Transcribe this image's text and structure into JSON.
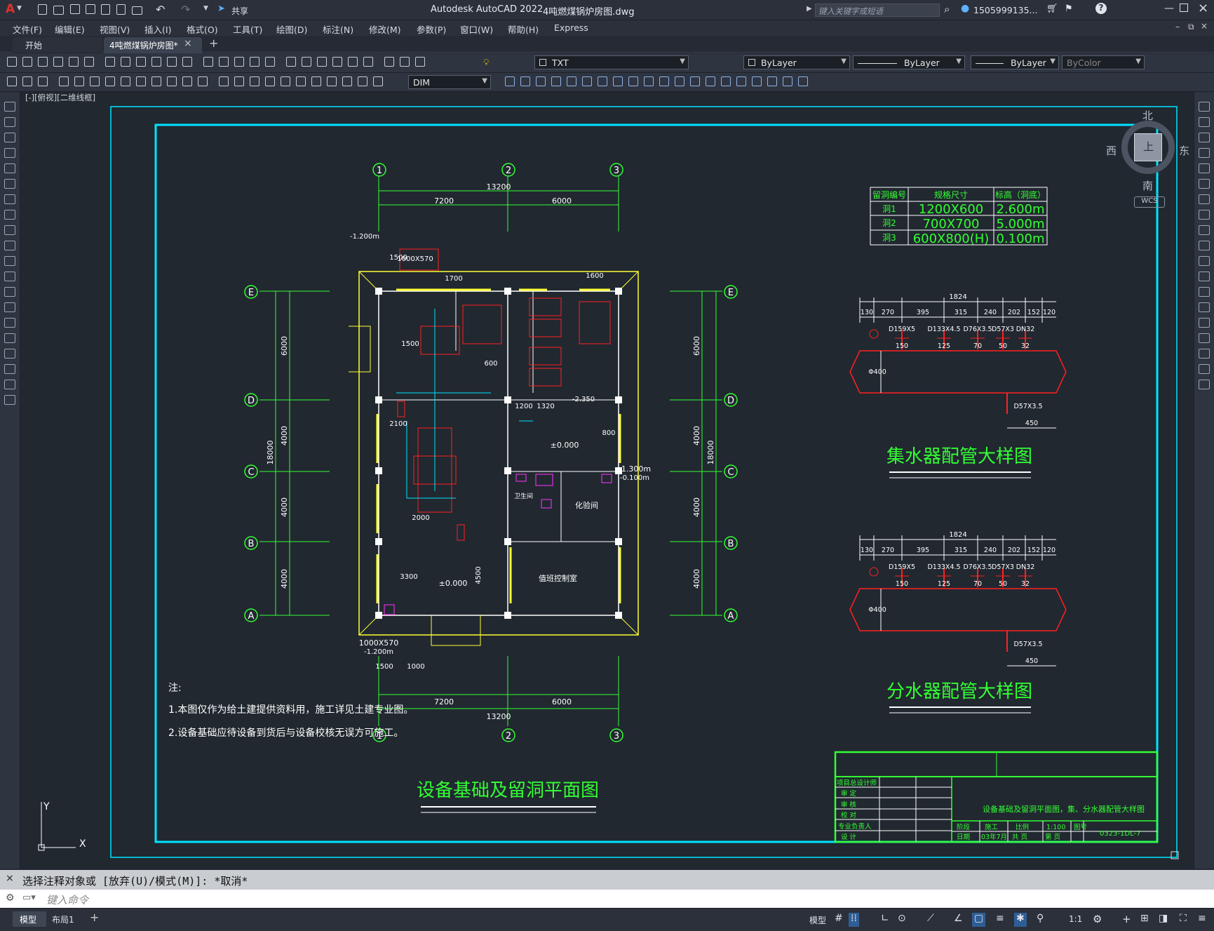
{
  "titlebar": {
    "app_title": "Autodesk AutoCAD 2022",
    "file_name": "4吨燃煤锅炉房图.dwg",
    "share_label": "共享",
    "search_placeholder": "键入关键字或短语",
    "user": "1505999135...",
    "logo": "A"
  },
  "menu": [
    "文件(F)",
    "编辑(E)",
    "视图(V)",
    "插入(I)",
    "格式(O)",
    "工具(T)",
    "绘图(D)",
    "标注(N)",
    "修改(M)",
    "参数(P)",
    "窗口(W)",
    "帮助(H)",
    "Express"
  ],
  "tabs": [
    {
      "label": "开始"
    },
    {
      "label": "4吨燃煤锅炉房图*"
    }
  ],
  "layer": {
    "current": "TXT",
    "color": "ByLayer",
    "linetype": "ByLayer",
    "lineweight": "ByLayer",
    "plotstyle": "ByColor"
  },
  "dimstyle": "DIM",
  "viewport_label": "[-][俯视][二维线框]",
  "viewcube": {
    "north": "北",
    "south": "南",
    "east": "东",
    "west": "西",
    "top": "上",
    "wcs": "WCS"
  },
  "ucs": {
    "x": "X",
    "y": "Y"
  },
  "drawing": {
    "plan_title": "设备基础及留洞平面图",
    "collector_title": "集水器配管大样图",
    "distributor_title": "分水器配管大样图",
    "notes": [
      "注:",
      "1.本图仅作为给土建提供资料用，施工详见土建专业图。",
      "2.设备基础应待设备到货后与设备校核无误方可施工。"
    ],
    "grid_cols": [
      "1",
      "2",
      "3"
    ],
    "grid_rows": [
      "E",
      "D",
      "C",
      "B",
      "A"
    ],
    "dims_top": {
      "total": "13200",
      "a": "7200",
      "b": "6000"
    },
    "dims_side": {
      "total": "18000",
      "e": "6000",
      "d": "4000",
      "c": "4000",
      "b": "4000"
    },
    "rooms": {
      "toilet": "卫生间",
      "lab": "化验间",
      "control": "值班控制室"
    },
    "misc_dims": [
      "1700",
      "1600",
      "1500",
      "2100",
      "2000",
      "3300",
      "4500",
      "±0.000",
      "±0.000",
      "1200",
      "1320",
      "800",
      "450",
      "1000X570",
      "-1.200m",
      "-2.350",
      "-1.300m",
      "-0.100m",
      "1000X570",
      "-1.200m",
      "1500",
      "1000",
      "600"
    ],
    "hole_table": {
      "headers": [
        "留洞编号",
        "规格尺寸",
        "标高（洞底）"
      ],
      "rows": [
        [
          "洞1",
          "1200X600",
          "2.600m"
        ],
        [
          "洞2",
          "700X700",
          "5.000m"
        ],
        [
          "洞3",
          "600X800(H)",
          "0.100m"
        ]
      ]
    },
    "header_detail": {
      "total": "1824",
      "segments": [
        "130",
        "270",
        "395",
        "315",
        "240",
        "202",
        "152",
        "120"
      ],
      "pipes": [
        "D159X5",
        "D133X4.5",
        "D76X3.5",
        "D57X3",
        "DN32"
      ],
      "dims_small": [
        "150",
        "125",
        "70",
        "50",
        "32"
      ],
      "dia": "Φ400",
      "bottom": "D57X3.5",
      "bottom_len": "450"
    },
    "titleblock": {
      "rows": [
        "项目总设计师",
        "审    定",
        "审    核",
        "校    对",
        "专业负责人",
        "设    计"
      ],
      "drawing_name": "设备基础及留洞平面图，集、分水器配管大样图",
      "stage_label": "阶段",
      "stage": "施工",
      "scale_label": "比例",
      "scale": "1:100",
      "date_label": "日期",
      "date": "03年7月",
      "pages": "共  页",
      "page": "第  页",
      "sheet_no_label": "图号",
      "sheet_no": "0323-1DL-7"
    }
  },
  "command": {
    "history": "选择注释对象或 [放弃(U)/模式(M)]: *取消*",
    "placeholder": "键入命令"
  },
  "layout_tabs": [
    "模型",
    "布局1"
  ],
  "status": {
    "model": "模型",
    "scale": "1:1"
  }
}
